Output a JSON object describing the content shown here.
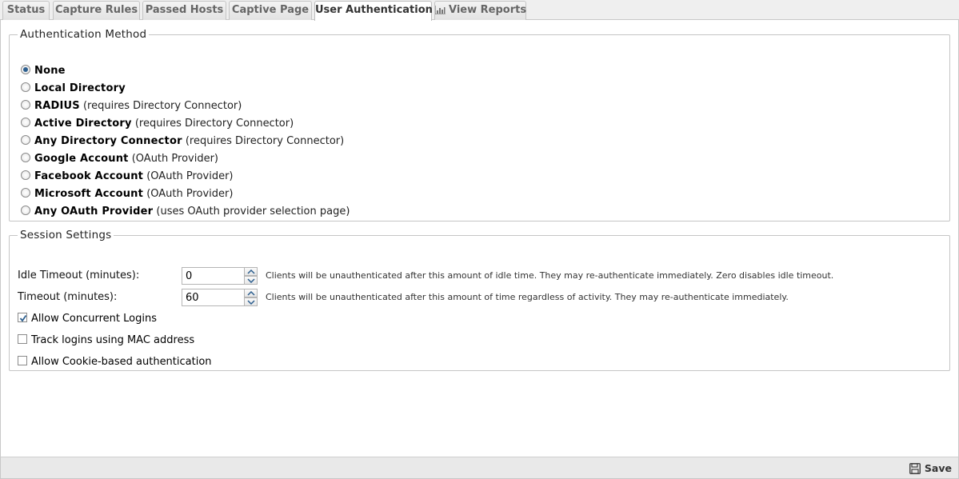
{
  "tabs": [
    {
      "label": "Status",
      "active": false
    },
    {
      "label": "Capture Rules",
      "active": false
    },
    {
      "label": "Passed Hosts",
      "active": false
    },
    {
      "label": "Captive Page",
      "active": false
    },
    {
      "label": "User Authentication",
      "active": true
    },
    {
      "label": "View Reports",
      "active": false,
      "icon": "bar-chart-icon"
    }
  ],
  "auth_method": {
    "legend": "Authentication Method",
    "selected": "None",
    "options": [
      {
        "name": "None",
        "note": ""
      },
      {
        "name": "Local Directory",
        "note": ""
      },
      {
        "name": "RADIUS",
        "note": "(requires Directory Connector)"
      },
      {
        "name": "Active Directory",
        "note": "(requires Directory Connector)"
      },
      {
        "name": "Any Directory Connector",
        "note": "(requires Directory Connector)"
      },
      {
        "name": "Google Account",
        "note": "(OAuth Provider)"
      },
      {
        "name": "Facebook Account",
        "note": "(OAuth Provider)"
      },
      {
        "name": "Microsoft Account",
        "note": "(OAuth Provider)"
      },
      {
        "name": "Any OAuth Provider",
        "note": "(uses OAuth provider selection page)"
      }
    ]
  },
  "session": {
    "legend": "Session Settings",
    "idle_timeout": {
      "label": "Idle Timeout (minutes):",
      "value": "0",
      "help": "Clients will be unauthenticated after this amount of idle time. They may re-authenticate immediately. Zero disables idle timeout."
    },
    "timeout": {
      "label": "Timeout (minutes):",
      "value": "60",
      "help": "Clients will be unauthenticated after this amount of time regardless of activity. They may re-authenticate immediately."
    },
    "checkboxes": [
      {
        "label": "Allow Concurrent Logins",
        "checked": true
      },
      {
        "label": "Track logins using MAC address",
        "checked": false
      },
      {
        "label": "Allow Cookie-based authentication",
        "checked": false
      }
    ]
  },
  "footer": {
    "save_label": "Save",
    "save_icon": "floppy-disk-icon"
  }
}
